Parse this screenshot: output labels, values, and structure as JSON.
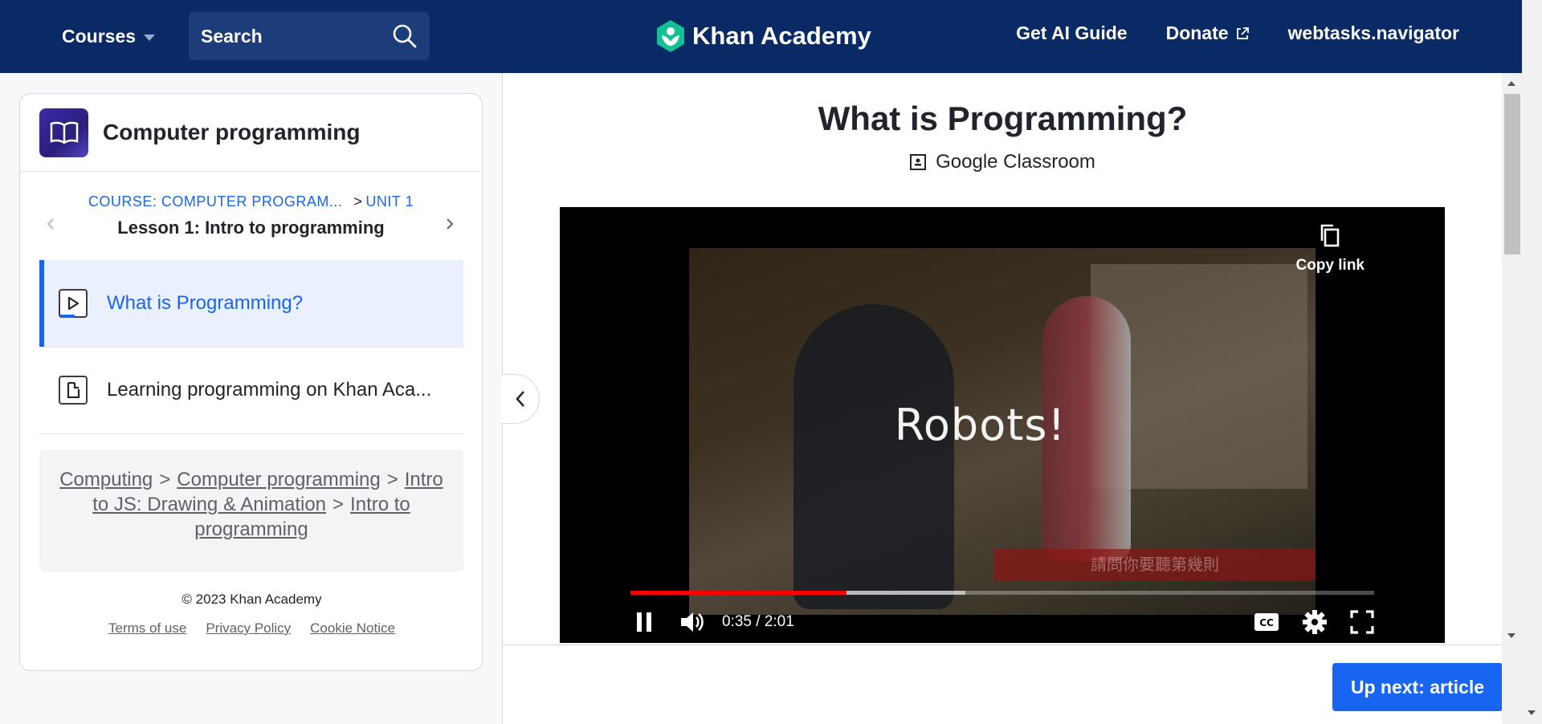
{
  "header": {
    "courses_label": "Courses",
    "search_placeholder": "Search",
    "logo_text": "Khan Academy",
    "nav": {
      "ai_guide": "Get AI Guide",
      "donate": "Donate",
      "user": "webtasks.navigator"
    },
    "colors": {
      "background": "#0a2a66",
      "logo_green": "#14bf96"
    }
  },
  "sidebar": {
    "course_title": "Computer programming",
    "breadcrumb_course": "COURSE: COMPUTER PROGRAM...",
    "breadcrumb_sep": ">",
    "breadcrumb_unit": "UNIT 1",
    "lesson_title": "Lesson 1: Intro to programming",
    "items": [
      {
        "label": "What is Programming?",
        "icon": "video-play-icon",
        "active": true
      },
      {
        "label": "Learning programming on Khan Aca...",
        "icon": "article-icon",
        "active": false
      }
    ],
    "path": {
      "computing": "Computing",
      "computer_programming": "Computer programming",
      "intro_js": "Intro to JS: Drawing & Animation",
      "intro_programming": "Intro to programming",
      "sep": ">"
    },
    "footer": {
      "copyright": "© 2023 Khan Academy",
      "terms": "Terms of use",
      "privacy": "Privacy Policy",
      "cookie": "Cookie Notice"
    }
  },
  "main": {
    "title": "What is Programming?",
    "google_classroom": "Google Classroom",
    "video": {
      "overlay_text": "Robots!",
      "copy_link": "Copy link",
      "time": "0:35 / 2:01",
      "played_fraction": 0.29,
      "buffered_fraction": 0.45,
      "subtitle_banner": "請問你要聽第幾則"
    },
    "next_button": "Up next: article",
    "accent": "#1865f2"
  }
}
